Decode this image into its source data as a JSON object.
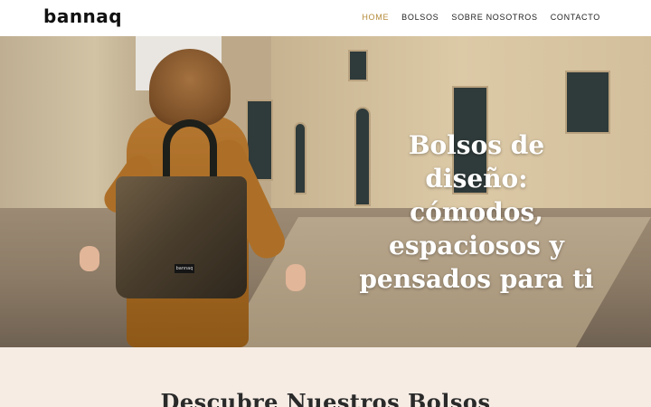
{
  "header": {
    "logo_text": "bannaq",
    "nav": {
      "home": "HOME",
      "bolsos": "BOLSOS",
      "sobre": "SOBRE NOSOTROS",
      "contacto": "CONTACTO"
    },
    "active_nav": "HOME",
    "accent_color": "#b58b3a"
  },
  "hero": {
    "title_line1": "Bolsos de diseño:",
    "title_line2": "cómodos,",
    "title_line3": "espaciosos y",
    "title_line4": "pensados para ti",
    "bag_label": "bannaq"
  },
  "section": {
    "title": "Descubre Nuestros Bolsos",
    "background": "#f6ece4"
  }
}
